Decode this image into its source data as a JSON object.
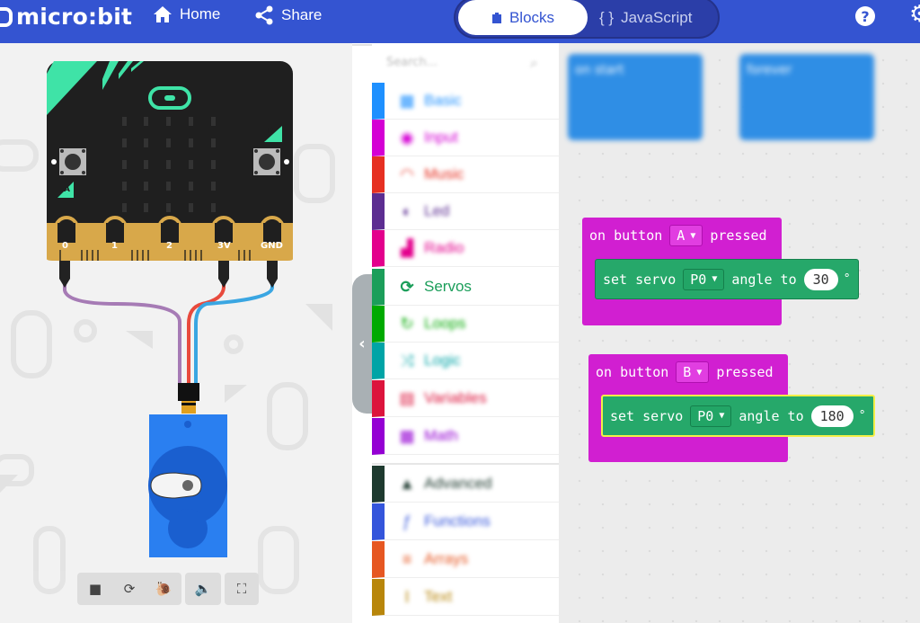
{
  "header": {
    "logo": "micro:bit",
    "home_label": "Home",
    "share_label": "Share",
    "tabs": {
      "blocks": "Blocks",
      "javascript": "JavaScript"
    },
    "help_label": "?"
  },
  "simulator": {
    "pins": [
      "0",
      "1",
      "2",
      "3V",
      "GND"
    ],
    "buttons": [
      "A",
      "B"
    ],
    "controls": [
      "stop-icon",
      "restart-icon",
      "slow-mo-icon",
      "mute-icon",
      "fullscreen-icon"
    ]
  },
  "toolbox": {
    "search_placeholder": "Search...",
    "categories": [
      {
        "label": "Basic",
        "color": "#1e90ff",
        "icon": "grid-icon",
        "glyph": "▦"
      },
      {
        "label": "Input",
        "color": "#d400d4",
        "icon": "input-icon",
        "glyph": "◉"
      },
      {
        "label": "Music",
        "color": "#e63022",
        "icon": "headphones-icon",
        "glyph": "◠"
      },
      {
        "label": "Led",
        "color": "#5c2d91",
        "icon": "toggle-icon",
        "glyph": "◐"
      },
      {
        "label": "Radio",
        "color": "#e3008c",
        "icon": "signal-icon",
        "glyph": "▟"
      },
      {
        "label": "Servos",
        "color": "#1b9e5a",
        "icon": "refresh-icon",
        "glyph": "⟳"
      },
      {
        "label": "Loops",
        "color": "#00aa00",
        "icon": "loop-icon",
        "glyph": "↻"
      },
      {
        "label": "Logic",
        "color": "#00a4a6",
        "icon": "shuffle-icon",
        "glyph": "⤨"
      },
      {
        "label": "Variables",
        "color": "#dc143c",
        "icon": "variables-icon",
        "glyph": "▤"
      },
      {
        "label": "Math",
        "color": "#9400d3",
        "icon": "calculator-icon",
        "glyph": "▦"
      },
      {
        "label": "Advanced",
        "color": "#1e3a2f",
        "icon": "chevron-up-icon",
        "glyph": "▲"
      },
      {
        "label": "Functions",
        "color": "#3455db",
        "icon": "functions-icon",
        "glyph": "ƒ"
      },
      {
        "label": "Arrays",
        "color": "#e65722",
        "icon": "list-icon",
        "glyph": "≡"
      },
      {
        "label": "Text",
        "color": "#b8860b",
        "icon": "text-icon",
        "glyph": "I"
      }
    ]
  },
  "workspace": {
    "ghost_blocks": [
      "on start",
      "forever"
    ],
    "event1": {
      "prefix": "on button",
      "button": "A",
      "suffix": "pressed",
      "stmt": {
        "prefix": "set servo",
        "pin": "P0",
        "mid": "angle to",
        "value": "30",
        "unit": "°"
      }
    },
    "event2": {
      "prefix": "on button",
      "button": "B",
      "suffix": "pressed",
      "stmt": {
        "prefix": "set servo",
        "pin": "P0",
        "mid": "angle to",
        "value": "180",
        "unit": "°"
      }
    }
  },
  "colors": {
    "header": "#3454d1",
    "event_block": "#d11fd1",
    "servo_block": "#26a86a",
    "ghost_block": "#2f8ee5"
  }
}
